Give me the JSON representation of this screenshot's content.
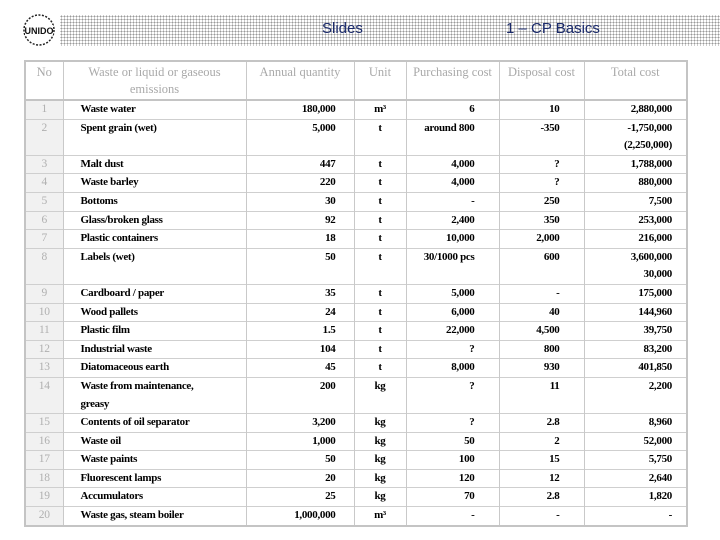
{
  "header": {
    "title_left": "Slides",
    "title_right": "1 – CP Basics",
    "logo_text": "UNIDO",
    "accent_color": "#1a2a6c"
  },
  "table": {
    "columns": [
      "No",
      "Waste or liquid or gaseous emissions",
      "Annual quantity",
      "Unit",
      "Purchasing cost",
      "Disposal cost",
      "Total cost"
    ],
    "rows": [
      {
        "no": "1",
        "desc": "Waste water",
        "qty": "180,000",
        "unit": "m³",
        "purchase": "6",
        "disposal": "10",
        "total": "2,880,000"
      },
      {
        "no": "2",
        "desc": "Spent grain (wet)",
        "qty": "5,000",
        "unit": "t",
        "purchase": "around 800",
        "disposal": "-350",
        "total": "-1,750,000",
        "total2": "(2,250,000)"
      },
      {
        "no": "3",
        "desc": "Malt dust",
        "qty": "447",
        "unit": "t",
        "purchase": "4,000",
        "disposal": "?",
        "total": "1,788,000"
      },
      {
        "no": "4",
        "desc": "Waste barley",
        "qty": "220",
        "unit": "t",
        "purchase": "4,000",
        "disposal": "?",
        "total": "880,000"
      },
      {
        "no": "5",
        "desc": "Bottoms",
        "qty": "30",
        "unit": "t",
        "purchase": "-",
        "disposal": "250",
        "total": "7,500"
      },
      {
        "no": "6",
        "desc": "Glass/broken glass",
        "qty": "92",
        "unit": "t",
        "purchase": "2,400",
        "disposal": "350",
        "total": "253,000"
      },
      {
        "no": "7",
        "desc": "Plastic containers",
        "qty": "18",
        "unit": "t",
        "purchase": "10,000",
        "disposal": "2,000",
        "total": "216,000"
      },
      {
        "no": "8",
        "desc": "Labels (wet)",
        "qty": "50",
        "unit": "t",
        "purchase": "30/1000 pcs",
        "disposal": "600",
        "total": "3,600,000",
        "total2": "30,000"
      },
      {
        "no": "9",
        "desc": "Cardboard / paper",
        "qty": "35",
        "unit": "t",
        "purchase": "5,000",
        "disposal": "-",
        "total": "175,000"
      },
      {
        "no": "10",
        "desc": "Wood pallets",
        "qty": "24",
        "unit": "t",
        "purchase": "6,000",
        "disposal": "40",
        "total": "144,960"
      },
      {
        "no": "11",
        "desc": "Plastic film",
        "qty": "1.5",
        "unit": "t",
        "purchase": "22,000",
        "disposal": "4,500",
        "total": "39,750"
      },
      {
        "no": "12",
        "desc": "Industrial waste",
        "qty": "104",
        "unit": "t",
        "purchase": "?",
        "disposal": "800",
        "total": "83,200"
      },
      {
        "no": "13",
        "desc": "Diatomaceous earth",
        "qty": "45",
        "unit": "t",
        "purchase": "8,000",
        "disposal": "930",
        "total": "401,850"
      },
      {
        "no": "14",
        "desc": "Waste from maintenance,",
        "desc2": "greasy",
        "qty": "200",
        "unit": "kg",
        "purchase": "?",
        "disposal": "11",
        "total": "2,200"
      },
      {
        "no": "15",
        "desc": "Contents of oil separator",
        "qty": "3,200",
        "unit": "kg",
        "purchase": "?",
        "disposal": "2.8",
        "total": "8,960"
      },
      {
        "no": "16",
        "desc": "Waste oil",
        "qty": "1,000",
        "unit": "kg",
        "purchase": "50",
        "disposal": "2",
        "total": "52,000"
      },
      {
        "no": "17",
        "desc": "Waste paints",
        "qty": "50",
        "unit": "kg",
        "purchase": "100",
        "disposal": "15",
        "total": "5,750"
      },
      {
        "no": "18",
        "desc": "Fluorescent lamps",
        "qty": "20",
        "unit": "kg",
        "purchase": "120",
        "disposal": "12",
        "total": "2,640"
      },
      {
        "no": "19",
        "desc": "Accumulators",
        "qty": "25",
        "unit": "kg",
        "purchase": "70",
        "disposal": "2.8",
        "total": "1,820"
      },
      {
        "no": "20",
        "desc": "Waste gas, steam boiler",
        "qty": "1,000,000",
        "unit": "m³",
        "purchase": "-",
        "disposal": "-",
        "total": "-"
      }
    ]
  }
}
